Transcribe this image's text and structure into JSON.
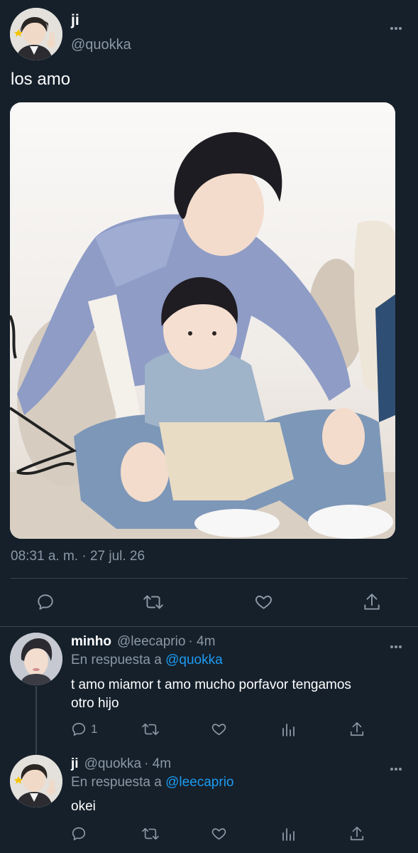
{
  "tweet": {
    "author_name": "ji",
    "author_handle": "@quokka",
    "text": "los amo",
    "timestamp": "08:31 a. m. · 27 jul. 26",
    "image_icon": "photo",
    "more_icon": "more-horizontal-icon"
  },
  "actions": {
    "reply_icon": "reply-icon",
    "retweet_icon": "retweet-icon",
    "like_icon": "heart-icon",
    "share_icon": "share-icon",
    "views_icon": "views-icon"
  },
  "replies": [
    {
      "author_name": "minho",
      "author_handle": "@leecaprio",
      "time": "· 4m",
      "replying_prefix": "En respuesta a",
      "replying_to": "@quokka",
      "text_line1": "t amo miamor t amo mucho porfavor tengamos",
      "text_line2": "otro hijo",
      "reply_count": "1"
    },
    {
      "author_name": "ji",
      "author_handle": "@quokka",
      "time": "· 4m",
      "replying_prefix": "En respuesta a",
      "replying_to": "@leecaprio",
      "text_line1": "okei"
    }
  ],
  "colors": {
    "background": "#15202b",
    "muted": "#8b98a5",
    "link": "#1d9bf0",
    "divider": "#38444d"
  }
}
